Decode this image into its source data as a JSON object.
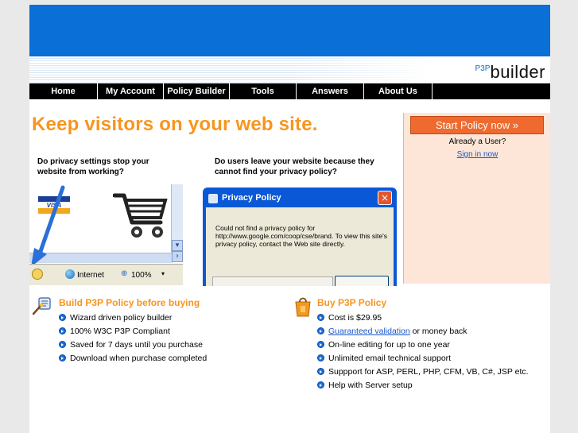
{
  "logo": {
    "sup": "P3P",
    "main": "builder"
  },
  "nav": {
    "items": [
      {
        "label": "Home"
      },
      {
        "label": "My Account"
      },
      {
        "label": "Policy Builder"
      },
      {
        "label": "Tools"
      },
      {
        "label": "Answers"
      },
      {
        "label": "About Us"
      }
    ]
  },
  "headline": "Keep visitors on your web site.",
  "questions": {
    "q1": "Do privacy settings stop your website from working?",
    "q2": "Do users leave your website because they cannot find your privacy policy?"
  },
  "browser": {
    "status": "Internet",
    "zoom": "100%",
    "card_text": "VISA"
  },
  "dialog": {
    "title": "Privacy Policy",
    "close": "×",
    "message": "Could not find a privacy policy for http://www.google.com/coop/cse/brand. To view this site's privacy policy, contact the Web site directly."
  },
  "side": {
    "start_button": "Start Policy now »",
    "already": "Already a User?",
    "signin": "Sign in now"
  },
  "build": {
    "title": "Build P3P Policy before buying",
    "items": [
      "Wizard driven policy builder",
      "100% W3C P3P Compliant",
      "Saved for 7 days until you purchase",
      "Download when purchase completed"
    ]
  },
  "buy": {
    "title": "Buy P3P Policy",
    "item0": "Cost is $29.95",
    "item1_link": "Guaranteed validation",
    "item1_rest": " or money back",
    "items": [
      "On-line editing for up to one year",
      "Unlimited email technical support",
      "Suppport for ASP, PERL, PHP, CFM, VB, C#, JSP etc.",
      "Help with Server setup"
    ]
  },
  "colors": {
    "accent": "#f7951d",
    "banner": "#0a6fd6",
    "side_bg": "#fde6d8",
    "start_button": "#ef6a2e"
  },
  "icons": [
    "wizard-icon",
    "shopping-box-icon",
    "bullet-arrow-icon",
    "shopping-cart-icon",
    "globe-icon",
    "arrow-icon"
  ]
}
